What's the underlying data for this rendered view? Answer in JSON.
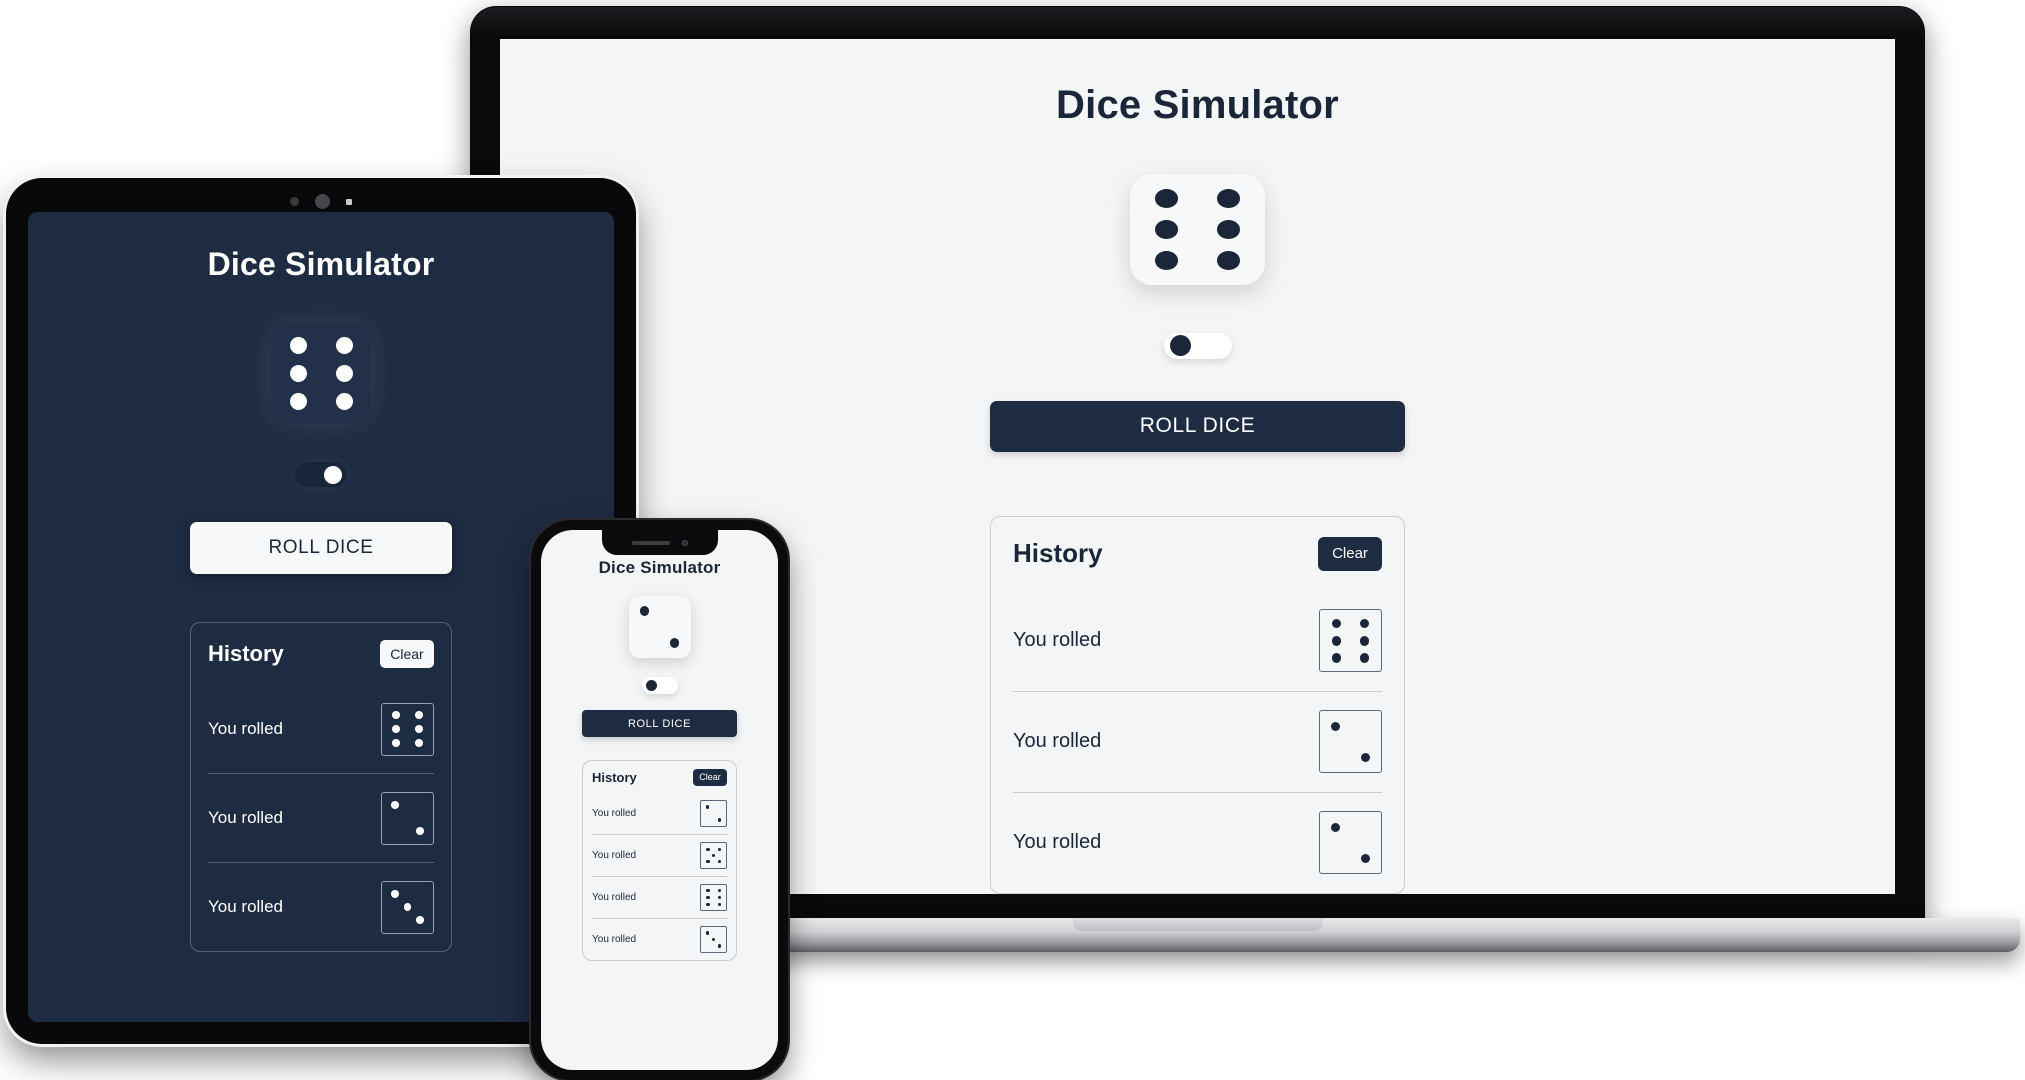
{
  "app": {
    "title": "Dice Simulator",
    "roll_button_label": "ROLL DICE",
    "history": {
      "title": "History",
      "clear_label": "Clear",
      "row_label": "You rolled"
    }
  },
  "colors": {
    "accent_navy": "#1e2c42",
    "pip_dark": "#1b2738",
    "light_background": "#f4f5f6",
    "dark_background": "#1e2c42",
    "die_face_light": "#f7f8f9",
    "die_face_dark": "#223149",
    "border_light": "#c9ccd1",
    "border_dark": "#54637c"
  },
  "devices": {
    "laptop": {
      "theme": "light",
      "current_die": 6,
      "toggle_on": false,
      "history_rolls": [
        6,
        2,
        2
      ]
    },
    "tablet": {
      "theme": "dark",
      "current_die": 6,
      "toggle_on": true,
      "history_rolls": [
        6,
        2,
        3
      ]
    },
    "phone": {
      "theme": "light",
      "current_die": 2,
      "toggle_on": false,
      "history_rolls": [
        2,
        5,
        6,
        3
      ]
    }
  }
}
